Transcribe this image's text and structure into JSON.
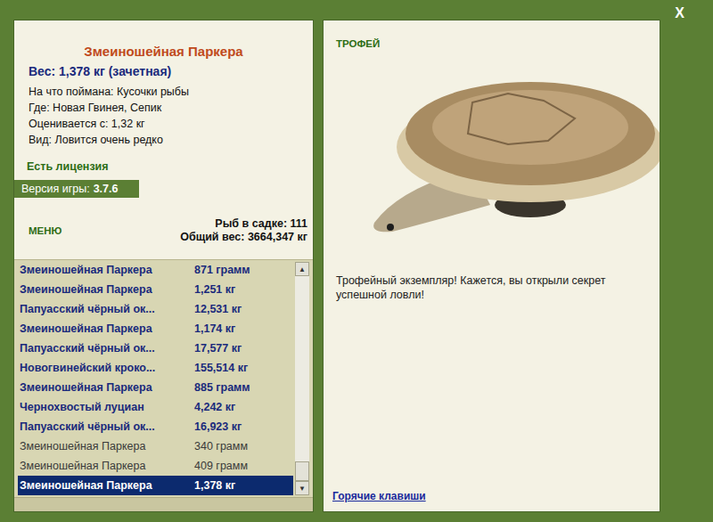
{
  "window": {
    "close": "X"
  },
  "catch": {
    "title": "Змеиношейная Паркера",
    "weight": "Вес: 1,378 кг (зачетная)",
    "details": [
      "На что поймана: Кусочки рыбы",
      "Где: Новая Гвинея, Сепик",
      "Оценивается с: 1,32 кг",
      "Вид: Ловится очень редко"
    ]
  },
  "license": "Есть лицензия",
  "version": {
    "label": "Версия игры:",
    "value": "3.7.6"
  },
  "menu": "МЕНЮ",
  "keepnet": {
    "count": "Рыб в садке: 111",
    "total": "Общий вес: 3664,347 кг"
  },
  "list": {
    "rows": [
      {
        "name": "Змеиношейная Паркера",
        "weight": "871 грамм",
        "trophy": true,
        "selected": false
      },
      {
        "name": "Змеиношейная Паркера",
        "weight": "1,251 кг",
        "trophy": true,
        "selected": false
      },
      {
        "name": "Папуасский чёрный ок...",
        "weight": "12,531 кг",
        "trophy": true,
        "selected": false
      },
      {
        "name": "Змеиношейная Паркера",
        "weight": "1,174 кг",
        "trophy": true,
        "selected": false
      },
      {
        "name": "Папуасский чёрный ок...",
        "weight": "17,577 кг",
        "trophy": true,
        "selected": false
      },
      {
        "name": "Новогвинейский кроко...",
        "weight": "155,514 кг",
        "trophy": true,
        "selected": false
      },
      {
        "name": "Змеиношейная Паркера",
        "weight": "885 грамм",
        "trophy": true,
        "selected": false
      },
      {
        "name": "Чернохвостый луциан",
        "weight": "4,242 кг",
        "trophy": true,
        "selected": false
      },
      {
        "name": "Папуасский чёрный ок...",
        "weight": "16,923 кг",
        "trophy": true,
        "selected": false
      },
      {
        "name": "Змеиношейная Паркера",
        "weight": "340 грамм",
        "trophy": false,
        "selected": false
      },
      {
        "name": "Змеиношейная Паркера",
        "weight": "409 грамм",
        "trophy": false,
        "selected": false
      },
      {
        "name": "Змеиношейная Паркера",
        "weight": "1,378 кг",
        "trophy": true,
        "selected": true
      }
    ],
    "scrollbar": {
      "up": "▲",
      "down": "▼",
      "level": 1
    }
  },
  "trophy": {
    "badge": "ТРОФЕЙ",
    "message": "Трофейный экземпляр! Кажется, вы открыли секрет успешной ловли!"
  },
  "hotkeys": "Горячие клавиши"
}
